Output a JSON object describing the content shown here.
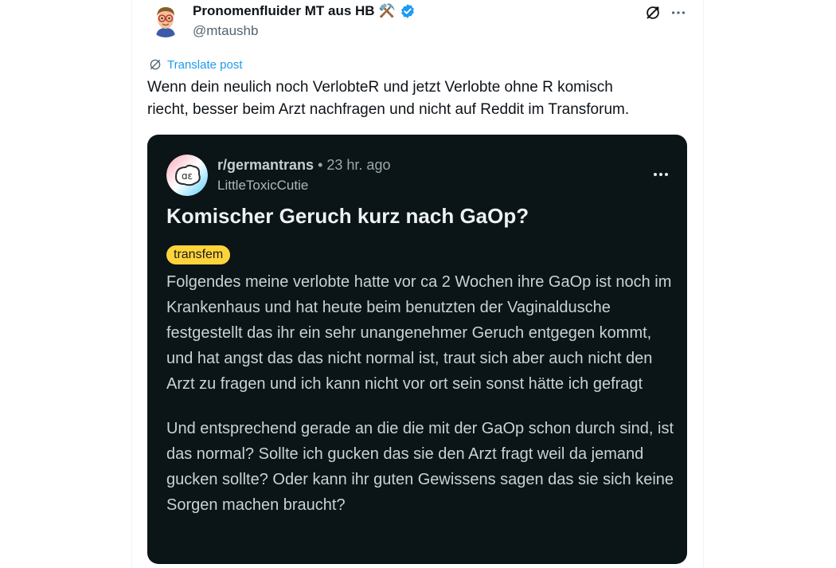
{
  "tweet": {
    "author_name": "Pronomenfluider MT aus HB",
    "author_emoji": "⚒️",
    "handle": "@mtaushb",
    "translate_label": "Translate post",
    "text": "Wenn dein neulich noch VerlobteR und jetzt Verlobte ohne R komisch\nriecht, besser beim Arzt nachfragen und nicht auf Reddit im Transforum."
  },
  "card": {
    "subreddit": "r/germantrans",
    "separator": "•",
    "time_ago": "23 hr. ago",
    "username": "LittleToxicCutie",
    "title": "Komischer Geruch kurz nach GaOp?",
    "flair": "transfem",
    "body_p1": "Folgendes meine verlobte hatte vor ca 2 Wochen ihre GaOp ist noch im Krankenhaus und hat heute beim benutzten der Vaginaldusche festgestellt das ihr ein sehr unangenehmer Geruch entgegen kommt, und hat angst das das nicht normal ist, traut sich aber auch nicht den Arzt zu fragen und ich kann nicht vor ort sein sonst hätte ich gefragt",
    "body_p2": "Und entsprechend gerade an die die mit der GaOp schon durch sind, ist das normal? Sollte ich gucken das sie den Arzt fragt weil da jemand gucken sollte? Oder kann ihr guten Gewissens sagen das sie sich keine Sorgen machen braucht?"
  },
  "icons": {
    "verified": "verified-badge-icon",
    "grok": "grok-icon",
    "more": "more-icon",
    "translate": "translate-icon"
  },
  "colors": {
    "accent": "#1d9bf0",
    "card_bg": "#0b1416",
    "flair_bg": "#ffd43b"
  }
}
